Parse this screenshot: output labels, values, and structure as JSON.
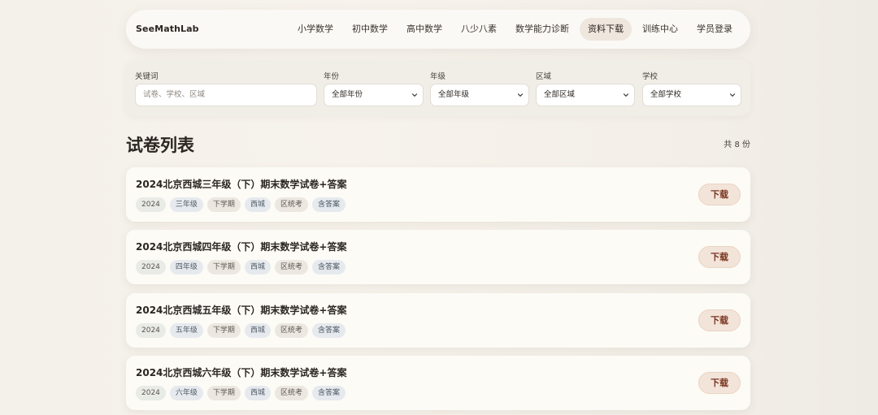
{
  "header": {
    "brand": "SeeMathLab",
    "nav": [
      {
        "label": "小学数学",
        "active": false
      },
      {
        "label": "初中数学",
        "active": false
      },
      {
        "label": "高中数学",
        "active": false
      },
      {
        "label": "八少八素",
        "active": false
      },
      {
        "label": "数学能力诊断",
        "active": false
      },
      {
        "label": "资料下载",
        "active": true
      },
      {
        "label": "训练中心",
        "active": false
      },
      {
        "label": "学员登录",
        "active": false
      }
    ]
  },
  "filters": {
    "keyword": {
      "label": "关键词",
      "placeholder": "试卷、学校、区域"
    },
    "year": {
      "label": "年份",
      "value": "全部年份"
    },
    "grade": {
      "label": "年级",
      "value": "全部年级"
    },
    "region": {
      "label": "区域",
      "value": "全部区域"
    },
    "school": {
      "label": "学校",
      "value": "全部学校"
    }
  },
  "list": {
    "title": "试卷列表",
    "count": "共 8 份",
    "download_label": "下载",
    "items": [
      {
        "title": "2024北京西城三年级（下）期末数学试卷+答案",
        "tags": [
          "2024",
          "三年级",
          "下学期",
          "西城",
          "区统考",
          "含答案"
        ]
      },
      {
        "title": "2024北京西城四年级（下）期末数学试卷+答案",
        "tags": [
          "2024",
          "四年级",
          "下学期",
          "西城",
          "区统考",
          "含答案"
        ]
      },
      {
        "title": "2024北京西城五年级（下）期末数学试卷+答案",
        "tags": [
          "2024",
          "五年级",
          "下学期",
          "西城",
          "区统考",
          "含答案"
        ]
      },
      {
        "title": "2024北京西城六年级（下）期末数学试卷+答案",
        "tags": [
          "2024",
          "六年级",
          "下学期",
          "西城",
          "区统考",
          "含答案"
        ]
      }
    ]
  }
}
